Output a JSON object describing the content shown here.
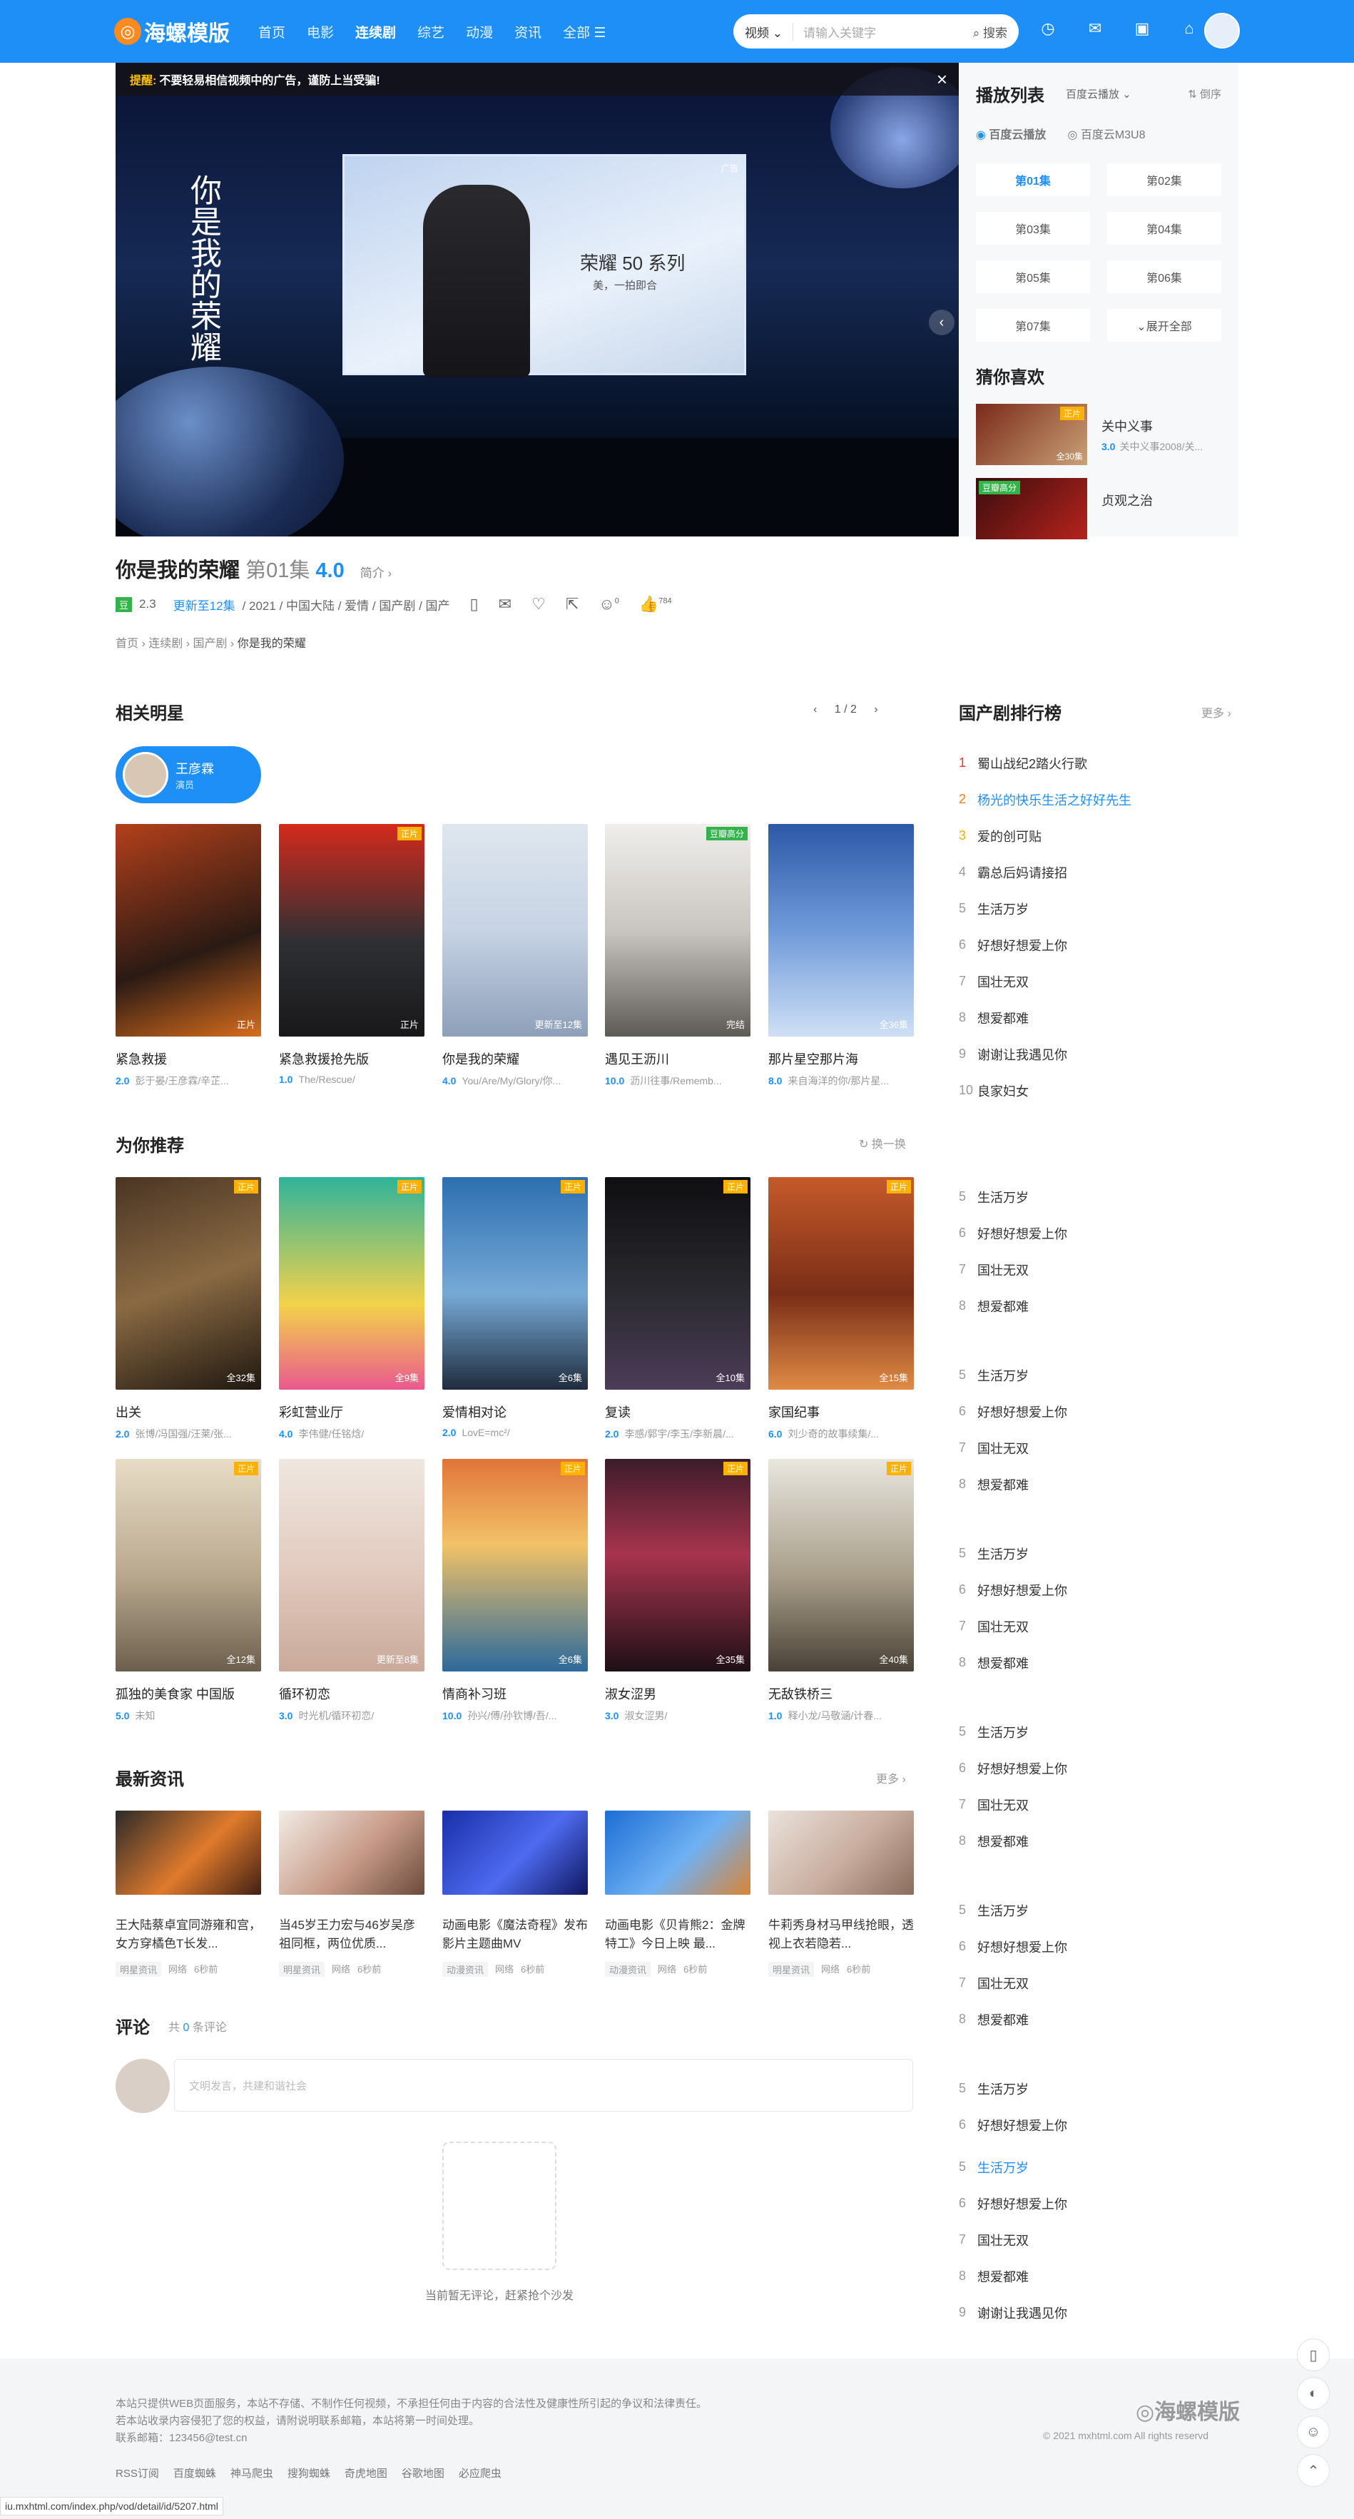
{
  "header": {
    "logo_text": "海螺模版",
    "nav": [
      "首页",
      "电影",
      "连续剧",
      "综艺",
      "动漫",
      "资讯",
      "全部 ☰"
    ],
    "search_select": "视频",
    "search_placeholder": "请输入关键字",
    "search_button": "搜索"
  },
  "player": {
    "tip_label": "提醒:",
    "tip_text": "不要轻易相信视频中的广告，谨防上当受骗!",
    "ad_title": "你是我的荣耀",
    "ad_product": "荣耀 50 系列",
    "ad_slogan": "美，一拍即合",
    "ad_tag": "广告"
  },
  "playlist": {
    "title": "播放列表",
    "source_select": "百度云播放",
    "order": "倒序",
    "sources": [
      "百度云播放",
      "百度云M3U8"
    ],
    "episodes": [
      "第01集",
      "第02集",
      "第03集",
      "第04集",
      "第05集",
      "第06集",
      "第07集",
      "⌄展开全部"
    ],
    "guess_title": "猜你喜欢",
    "guess": [
      {
        "name": "关中义事",
        "score": "3.0",
        "desc": "关中义事2008/关...",
        "badge": "正片",
        "eps": "全30集"
      },
      {
        "name": "贞观之治",
        "score": "",
        "desc": "",
        "badge": "豆瓣高分",
        "eps": ""
      }
    ]
  },
  "title": {
    "name": "你是我的荣耀",
    "episode": "第01集",
    "score": "4.0",
    "intro": "简介 ›",
    "douban": "豆",
    "douban_score": "2.3",
    "update": "更新至12集",
    "meta": "/ 2021 / 中国大陆 / 爱情 / 国产剧 / 国产",
    "comments_count": "0",
    "likes": "784",
    "breadcrumb": [
      "首页",
      "连续剧",
      "国产剧",
      "你是我的荣耀"
    ]
  },
  "stars": {
    "title": "相关明星",
    "pager": "1 / 2",
    "star_name": "王彦霖",
    "star_role": "演员",
    "cards": [
      {
        "name": "紧急救援",
        "score": "2.0",
        "sub": "彭于晏/王彦霖/辛芷...",
        "badge": "",
        "eps": "正片"
      },
      {
        "name": "紧急救援抢先版",
        "score": "1.0",
        "sub": "The/Rescue/",
        "badge": "正片",
        "eps": "正片"
      },
      {
        "name": "你是我的荣耀",
        "score": "4.0",
        "sub": "You/Are/My/Glory/你...",
        "badge": "",
        "eps": "更新至12集"
      },
      {
        "name": "遇见王沥川",
        "score": "10.0",
        "sub": "沥川往事/Rememb...",
        "badge": "豆瓣高分",
        "eps": "完结"
      },
      {
        "name": "那片星空那片海",
        "score": "8.0",
        "sub": "来自海洋的你/那片星...",
        "badge": "",
        "eps": "全36集"
      }
    ]
  },
  "recommend": {
    "title": "为你推荐",
    "refresh": "换一换",
    "cards": [
      {
        "name": "出关",
        "score": "2.0",
        "sub": "张博/冯国强/汪莱/张...",
        "badge": "正片",
        "eps": "全32集"
      },
      {
        "name": "彩虹营业厅",
        "score": "4.0",
        "sub": "李伟健/任铭焓/",
        "badge": "正片",
        "eps": "全9集"
      },
      {
        "name": "爱情相对论",
        "score": "2.0",
        "sub": "LovE=mc²/",
        "badge": "正片",
        "eps": "全6集"
      },
      {
        "name": "复读",
        "score": "2.0",
        "sub": "李感/郭宇/李玉/李新晨/...",
        "badge": "正片",
        "eps": "全10集"
      },
      {
        "name": "家国纪事",
        "score": "6.0",
        "sub": "刘少奇的故事续集/...",
        "badge": "正片",
        "eps": "全15集"
      },
      {
        "name": "孤独的美食家 中国版",
        "score": "5.0",
        "sub": "未知",
        "badge": "正片",
        "eps": "全12集"
      },
      {
        "name": "循环初恋",
        "score": "3.0",
        "sub": "时光机/循环初恋/",
        "badge": "",
        "eps": "更新至8集"
      },
      {
        "name": "情商补习班",
        "score": "10.0",
        "sub": "孙兴/傅/孙钦博/吾/...",
        "badge": "正片",
        "eps": "全6集"
      },
      {
        "name": "淑女涩男",
        "score": "3.0",
        "sub": "淑女涩男/",
        "badge": "正片",
        "eps": "全35集"
      },
      {
        "name": "无敌铁桥三",
        "score": "1.0",
        "sub": "释小龙/马敬涵/计春...",
        "badge": "正片",
        "eps": "全40集"
      }
    ]
  },
  "ranking": {
    "title": "国产剧排行榜",
    "more": "更多 ›",
    "items": [
      "蜀山战纪2踏火行歌",
      "杨光的快乐生活之好好先生",
      "爱的创可贴",
      "霸总后妈请接招",
      "生活万岁",
      "好想好想爱上你",
      "国壮无双",
      "想爱都难",
      "谢谢让我遇见你",
      "良家妇女"
    ],
    "repeat_items": [
      "生活万岁",
      "好想好想爱上你",
      "国壮无双",
      "想爱都难"
    ],
    "repeat_numbers": [
      "5",
      "6",
      "7",
      "8"
    ],
    "last_block": [
      "生活万岁",
      "好想好想爱上你",
      "国壮无双",
      "想爱都难",
      "谢谢让我遇见你"
    ],
    "last_numbers": [
      "5",
      "6",
      "7",
      "8",
      "9"
    ]
  },
  "news": {
    "title": "最新资讯",
    "more": "更多 ›",
    "items": [
      {
        "title": "王大陆蔡卓宜同游雍和宫，女方穿橘色T长发...",
        "cat": "明星资讯",
        "src": "网络",
        "time": "6秒前"
      },
      {
        "title": "当45岁王力宏与46岁吴彦祖同框，两位优质...",
        "cat": "明星资讯",
        "src": "网络",
        "time": "6秒前"
      },
      {
        "title": "动画电影《魔法奇程》发布影片主题曲MV",
        "cat": "动漫资讯",
        "src": "网络",
        "time": "6秒前"
      },
      {
        "title": "动画电影《贝肯熊2：金牌特工》今日上映 最...",
        "cat": "动漫资讯",
        "src": "网络",
        "time": "6秒前"
      },
      {
        "title": "牛莉秀身材马甲线抢眼，透视上衣若隐若...",
        "cat": "明星资讯",
        "src": "网络",
        "time": "6秒前"
      }
    ]
  },
  "comments": {
    "title": "评论",
    "count_prefix": "共",
    "count": "0",
    "count_suffix": "条评论",
    "placeholder": "文明发言，共建和谐社会",
    "empty": "当前暂无评论，赶紧抢个沙发"
  },
  "footer": {
    "line1": "本站只提供WEB页面服务，本站不存储、不制作任何视频，不承担任何由于内容的合法性及健康性所引起的争议和法律责任。",
    "line2": "若本站收录内容侵犯了您的权益，请附说明联系邮箱，本站将第一时间处理。",
    "line3": "联系邮箱：123456@test.cn",
    "links": [
      "RSS订阅",
      "百度蜘蛛",
      "神马爬虫",
      "搜狗蜘蛛",
      "奇虎地图",
      "谷歌地图",
      "必应爬虫"
    ],
    "logo": "海螺模版",
    "copy": "© 2021 mxhtml.com All rights reservd",
    "status_url": "iu.mxhtml.com/index.php/vod/detail/id/5207.html"
  }
}
